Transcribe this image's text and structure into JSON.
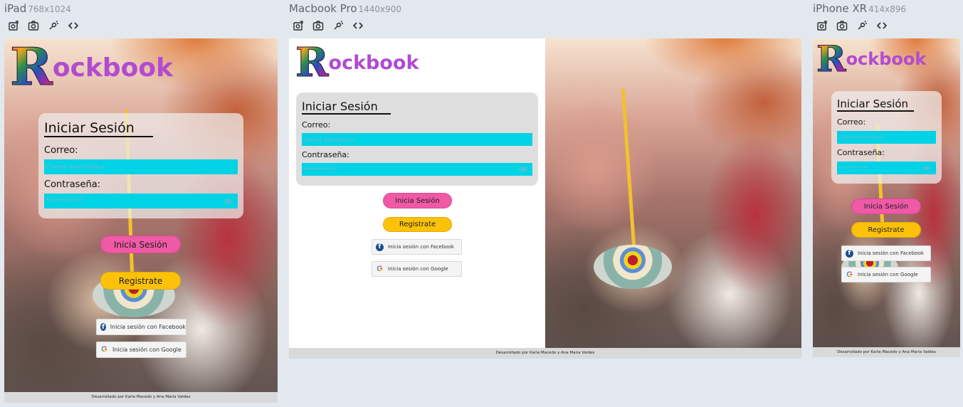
{
  "devices": [
    {
      "name": "iPad",
      "dims": "768x1024"
    },
    {
      "name": "Macbook Pro",
      "dims": "1440x900"
    },
    {
      "name": "iPhone XR",
      "dims": "414x896"
    }
  ],
  "toolbar_icons": [
    "rotate-device-icon",
    "screenshot-icon",
    "debug-tool-icon",
    "code-icon"
  ],
  "app": {
    "logo_initial": "R",
    "logo_rest": "ockbook",
    "login_title": "Iniciar Sesión",
    "email_label": "Correo:",
    "email_placeholder": "Correo electrónico",
    "password_label": "Contraseña:",
    "password_placeholder": "************",
    "login_button": "Inicia Sesión",
    "register_button": "Registrate",
    "facebook_button": "Inicia sesión con Facebook",
    "google_button": "Inicia sesión con Google",
    "footer": "Desarrollado por Karla Macedo y Ana Maria Valdes"
  },
  "colors": {
    "brand_purple": "#b14bd0",
    "input_cyan": "#00d3e6",
    "button_pink": "#ef59a6",
    "button_yellow": "#fcc20a"
  }
}
